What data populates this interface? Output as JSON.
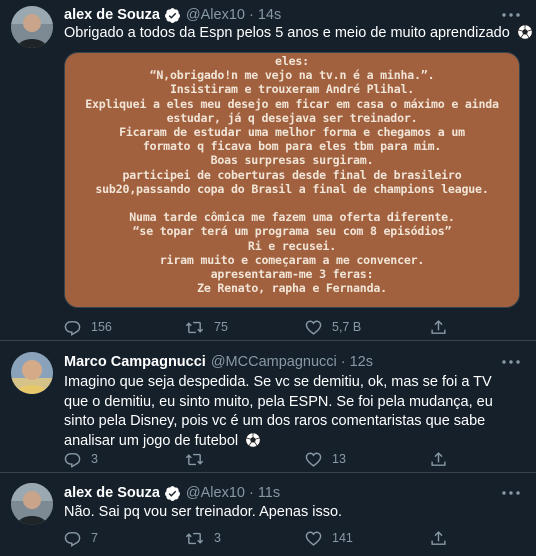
{
  "tweets": [
    {
      "name": "alex de Souza",
      "handle": "@Alex10",
      "time": "14s",
      "text": "Obrigado a todos da Espn pelos 5 anos e meio de muito aprendizado",
      "media_lines": [
        "eles:",
        "“N,obrigado!n me vejo na tv.n é a minha.”.",
        "Insistiram e trouxeram André Plihal.",
        "Expliquei a eles meu desejo em ficar em casa o máximo e ainda",
        "estudar, já q desejava ser treinador.",
        "Ficaram de estudar uma melhor forma e chegamos a um",
        "formato q ficava bom para eles tbm para mim.",
        "Boas surpresas surgiram.",
        "participei de coberturas desde final de brasileiro",
        "sub20,passando copa do Brasil a final de champions league.",
        "",
        "Numa tarde cômica me fazem uma oferta diferente.",
        "“se topar terá um programa seu com 8 episódios”",
        "Ri e recusei.",
        "riram muito e começaram a me convencer.",
        "apresentaram-me 3 feras:",
        "Ze Renato, rapha e Fernanda."
      ],
      "stats": {
        "replies": "156",
        "retweets": "75",
        "likes": "5,7 B"
      }
    },
    {
      "name": "Marco Campagnucci",
      "handle": "@MCCampagnucci",
      "time": "12s",
      "text": "Imagino que seja despedida. Se vc se demitiu, ok, mas se foi a TV que o demitiu, eu sinto muito, pela ESPN. Se foi pela mudança, eu sinto pela Disney, pois vc é um dos raros comentaristas que sabe analisar um jogo de futebol",
      "stats": {
        "replies": "3",
        "retweets": "",
        "likes": "13"
      }
    },
    {
      "name": "alex de Souza",
      "handle": "@Alex10",
      "time": "11s",
      "text": "Não. Sai pq vou ser treinador. Apenas isso.",
      "stats": {
        "replies": "7",
        "retweets": "3",
        "likes": "141"
      }
    }
  ],
  "icons": {
    "reply": "reply-icon",
    "retweet": "retweet-icon",
    "like": "heart-icon",
    "share": "share-icon",
    "more": "more-icon",
    "verified": "verified-badge-icon"
  },
  "colors": {
    "background": "#15202b",
    "secondary_text": "#8899a6",
    "divider": "#38444d",
    "image_bg": "#a2613e",
    "image_text": "#f1e5d8"
  }
}
